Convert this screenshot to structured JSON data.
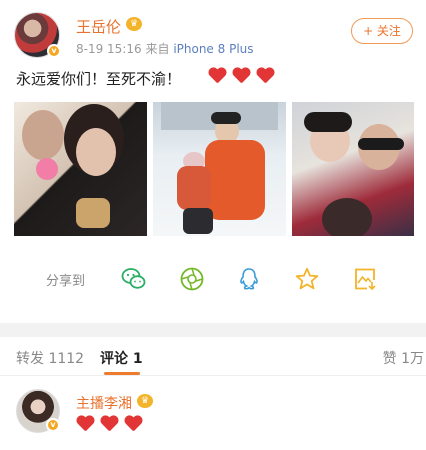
{
  "post": {
    "author": "王岳伦",
    "crown_glyph": "♛",
    "verified_glyph": "v",
    "date": "8-19 15:16",
    "via": "来自",
    "device": "iPhone 8 Plus",
    "follow_label": "+ 关注",
    "text": "永远爱你们！至死不渝！",
    "heart_count": 3
  },
  "share": {
    "label": "分享到",
    "targets": [
      "wechat-icon",
      "moments-icon",
      "qq-icon",
      "favorite-icon",
      "save-image-icon"
    ]
  },
  "tabs": {
    "repost": "转发 1112",
    "comment": "评论 1",
    "like": "赞 1万"
  },
  "comment": {
    "author": "主播李湘",
    "crown_glyph": "♛",
    "verified_glyph": "v",
    "heart_count": 3
  },
  "colors": {
    "accent": "#e8732e",
    "heart": "#e23535",
    "wechat": "#2aae67",
    "moments": "#74b82a",
    "qq": "#3a9ad9",
    "favorite": "#f3b32a"
  }
}
